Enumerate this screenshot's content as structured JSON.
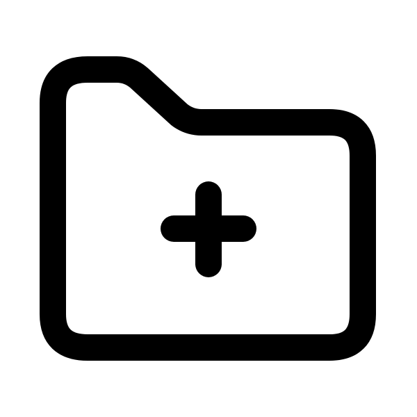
{
  "icon": {
    "name": "folder-add-icon",
    "stroke_color": "#000000",
    "background_color": "#ffffff"
  }
}
